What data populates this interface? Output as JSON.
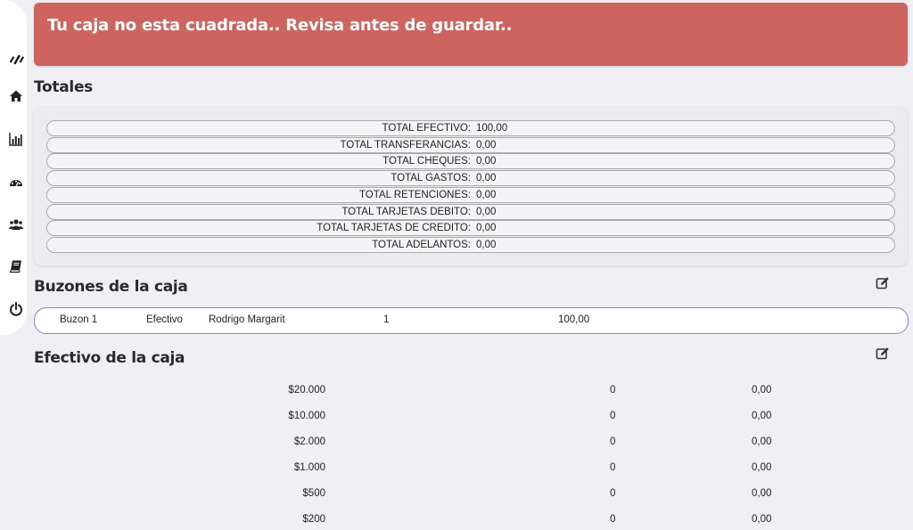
{
  "sidebar": {
    "items": [
      {
        "icon": "logo-icon"
      },
      {
        "icon": "home-icon"
      },
      {
        "icon": "bar-chart-icon"
      },
      {
        "icon": "dashboard-icon"
      },
      {
        "icon": "users-icon"
      },
      {
        "icon": "book-icon"
      },
      {
        "icon": "power-icon"
      }
    ]
  },
  "alert": {
    "message": "Tu caja no esta cuadrada.. Revisa antes de guardar..",
    "color": "#cd6460"
  },
  "totals": {
    "title": "Totales",
    "rows": [
      {
        "label": "TOTAL EFECTIVO:",
        "value": "100,00"
      },
      {
        "label": "TOTAL TRANSFERANCIAS:",
        "value": "0,00"
      },
      {
        "label": "TOTAL CHEQUES:",
        "value": "0,00"
      },
      {
        "label": "TOTAL GASTOS:",
        "value": "0,00"
      },
      {
        "label": "TOTAL RETENCIONES:",
        "value": "0,00"
      },
      {
        "label": "TOTAL TARJETAS DEBITO:",
        "value": "0,00"
      },
      {
        "label": "TOTAL TARJETAS DE CREDITO:",
        "value": "0,00"
      },
      {
        "label": "TOTAL ADELANTOS:",
        "value": "0,00"
      }
    ]
  },
  "buzones": {
    "title": "Buzones de la caja",
    "edit_icon": "edit-icon",
    "rows": [
      {
        "name": "Buzon 1",
        "type": "Efectivo",
        "user": "Rodrigo Margarit",
        "qty": "1",
        "amount": "100,00"
      }
    ]
  },
  "efectivo": {
    "title": "Efectivo de la caja",
    "edit_icon": "edit-icon",
    "rows": [
      {
        "denomination": "$20.000",
        "qty": "0",
        "subtotal": "0,00"
      },
      {
        "denomination": "$10.000",
        "qty": "0",
        "subtotal": "0,00"
      },
      {
        "denomination": "$2.000",
        "qty": "0",
        "subtotal": "0,00"
      },
      {
        "denomination": "$1.000",
        "qty": "0",
        "subtotal": "0,00"
      },
      {
        "denomination": "$500",
        "qty": "0",
        "subtotal": "0,00"
      },
      {
        "denomination": "$200",
        "qty": "0",
        "subtotal": "0,00"
      }
    ]
  }
}
